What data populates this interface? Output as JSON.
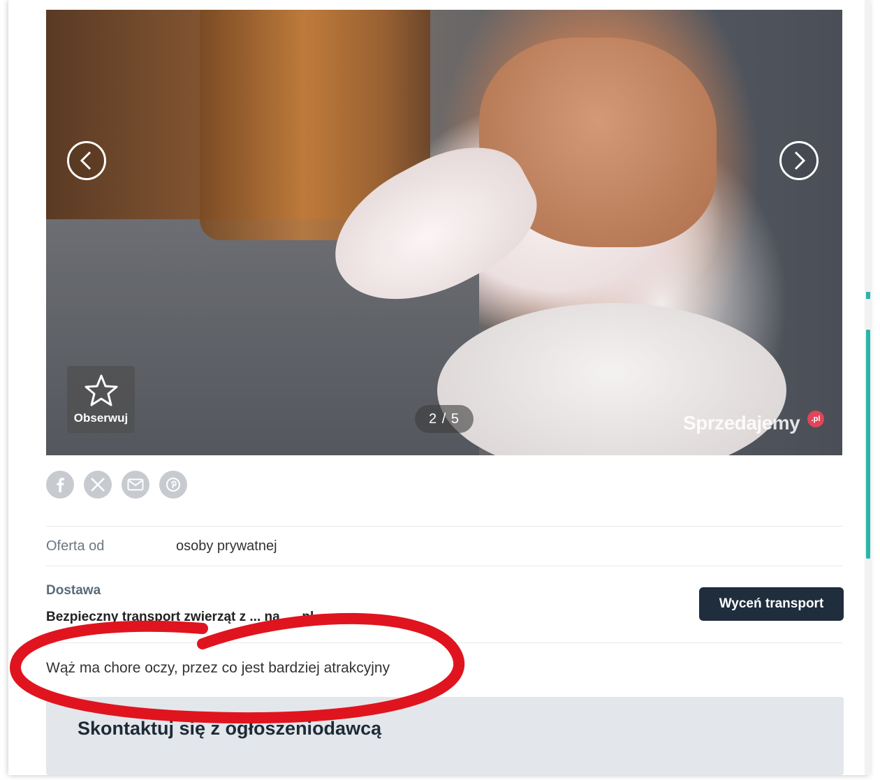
{
  "gallery": {
    "counter": "2 / 5",
    "follow_label": "Obserwuj",
    "watermark": "Sprzedajemy",
    "watermark_suffix": ".pl",
    "prev_icon": "chevron-left-icon",
    "next_icon": "chevron-right-icon"
  },
  "share": {
    "icons": [
      "facebook-icon",
      "x-icon",
      "email-icon",
      "pinterest-icon"
    ]
  },
  "details": {
    "offer_from_label": "Oferta od",
    "offer_from_value": "osoby prywatnej",
    "delivery_title": "Dostawa",
    "delivery_text": "Bezpieczny transport zwierząt z ... na ... .pl",
    "quote_button": "Wyceń transport"
  },
  "description": "Wąż ma chore oczy, przez co jest bardziej atrakcyjny",
  "contact": {
    "title": "Skontaktuj się z ogłoszeniodawcą"
  },
  "colors": {
    "accent": "#2bb5a8",
    "button_dark": "#1f2d3d",
    "annotation_red": "#e0141e"
  }
}
